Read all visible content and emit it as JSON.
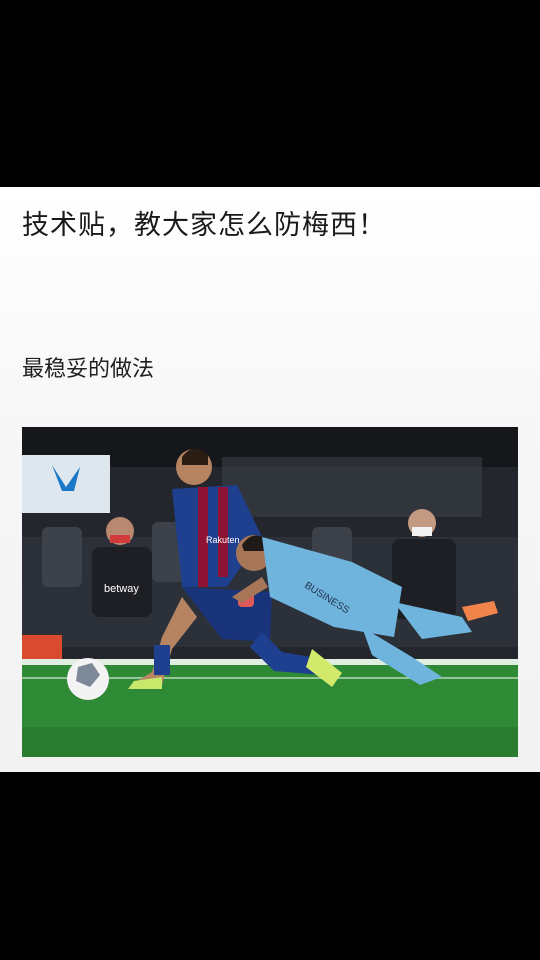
{
  "post": {
    "title": "技术贴，教大家怎么防梅西！",
    "subtitle": "最稳妥的做法"
  },
  "photo": {
    "description_icon": "soccer-tackle-photo",
    "jersey_name_left": "Rakuten",
    "jersey_name_right": "BUSINESS",
    "ad_text": "betway",
    "colors": {
      "pitch": "#2f8a35",
      "barca_blue": "#1f3f8f",
      "barca_red": "#8e1233",
      "keeper_blue": "#6fb4dd"
    }
  }
}
